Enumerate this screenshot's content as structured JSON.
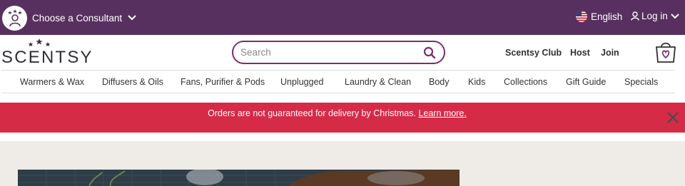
{
  "topbar": {
    "consultant_label": "Choose a Consultant",
    "language_label": "English",
    "login_label": "Log in"
  },
  "brand": {
    "logo_text": "SCENTSY"
  },
  "search": {
    "placeholder": "Search"
  },
  "header_links": [
    "Scentsy Club",
    "Host",
    "Join"
  ],
  "nav": [
    "Warmers & Wax",
    "Diffusers & Oils",
    "Fans, Purifier & Pods",
    "Unplugged",
    "Laundry & Clean",
    "Body",
    "Kids",
    "Collections",
    "Gift Guide",
    "Specials"
  ],
  "alert": {
    "message": "Orders are not guaranteed for delivery by Christmas.",
    "link": "Learn more."
  },
  "colors": {
    "topbar": "#58305f",
    "accent": "#7b2c73",
    "alert": "#d52b47",
    "hero_bg": "#efebe6"
  },
  "icons": [
    "consultant-avatar-icon",
    "chevron-down-icon",
    "us-flag-icon",
    "user-icon",
    "search-icon",
    "shopping-bag-icon",
    "close-icon"
  ]
}
